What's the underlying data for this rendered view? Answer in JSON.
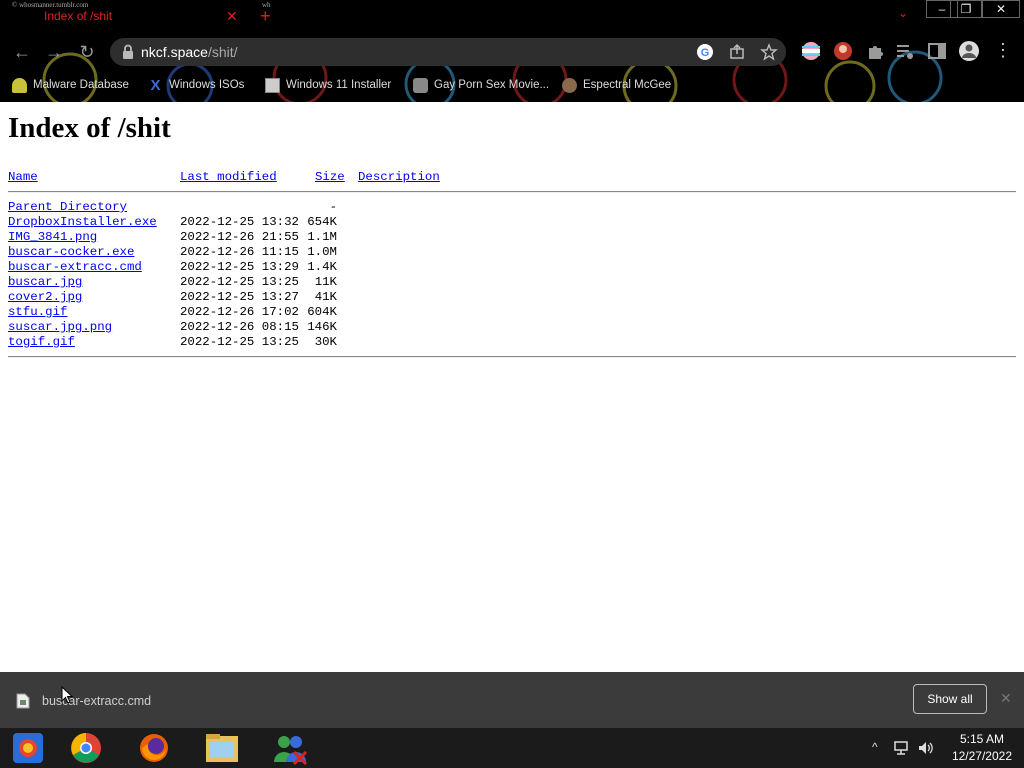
{
  "browser": {
    "tab": {
      "title": "Index of /shit",
      "caption": "© whosmanner.tumblr.com"
    },
    "new_tab_label": "+",
    "second_caption": "wh",
    "url_host": "nkcf.space",
    "url_path": "/shit/",
    "bookmarks": [
      {
        "label": "Malware Database",
        "icon": "user-icon"
      },
      {
        "label": "Windows ISOs",
        "icon": "x-icon"
      },
      {
        "label": "Windows 11 Installer",
        "icon": "image-icon"
      },
      {
        "label": "Gay Porn Sex Movie...",
        "icon": "box-icon"
      },
      {
        "label": "Espectral McGee",
        "icon": "face-icon"
      }
    ]
  },
  "page": {
    "heading": "Index of /shit",
    "columns": {
      "name": "Name",
      "last_modified": "Last modified",
      "size": "Size",
      "description": "Description"
    },
    "parent": {
      "name": "Parent Directory",
      "size": "-"
    },
    "files": [
      {
        "name": "DropboxInstaller.exe",
        "modified": "2022-12-25 13:32",
        "size": "654K"
      },
      {
        "name": "IMG_3841.png",
        "modified": "2022-12-26 21:55",
        "size": "1.1M"
      },
      {
        "name": "buscar-cocker.exe",
        "modified": "2022-12-26 11:15",
        "size": "1.0M"
      },
      {
        "name": "buscar-extracc.cmd",
        "modified": "2022-12-25 13:29",
        "size": "1.4K"
      },
      {
        "name": "buscar.jpg",
        "modified": "2022-12-25 13:25",
        "size": "11K"
      },
      {
        "name": "cover2.jpg",
        "modified": "2022-12-25 13:27",
        "size": "41K"
      },
      {
        "name": "stfu.gif",
        "modified": "2022-12-26 17:02",
        "size": "604K"
      },
      {
        "name": "suscar.jpg.png",
        "modified": "2022-12-26 08:15",
        "size": "146K"
      },
      {
        "name": "togif.gif",
        "modified": "2022-12-25 13:25",
        "size": "30K"
      }
    ]
  },
  "downloads": {
    "item_name": "buscar-extracc.cmd",
    "show_all_label": "Show all"
  },
  "taskbar": {
    "time": "5:15 AM",
    "date": "12/27/2022"
  },
  "colors": {
    "link": "#0000ee",
    "tab_accent": "#e02020",
    "download_bar": "#3b3b3b",
    "taskbar": "#1b1b1b"
  }
}
